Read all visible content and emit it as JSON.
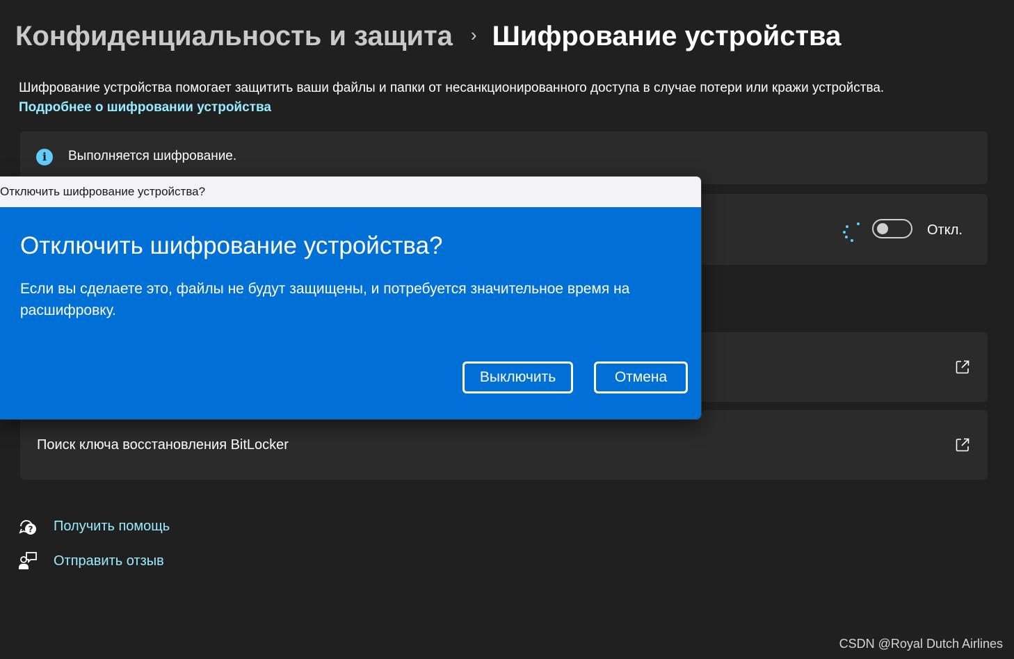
{
  "breadcrumb": {
    "parent": "Конфиденциальность и защита",
    "separator": "›",
    "current": "Шифрование устройства"
  },
  "description": "Шифрование устройства помогает защитить ваши файлы и папки от несанкционированного доступа в случае потери или кражи устройства.",
  "learn_more_link": "Подробнее о шифровании устройства",
  "status": {
    "icon": "info-icon",
    "text": "Выполняется шифрование."
  },
  "encryption_toggle": {
    "state_label": "Откл.",
    "on": false
  },
  "links": [
    {
      "label": "",
      "icon": "external-link-icon"
    },
    {
      "label": "Поиск ключа восстановления BitLocker",
      "icon": "external-link-icon"
    }
  ],
  "help": {
    "get_help": "Получить помощь",
    "send_feedback": "Отправить отзыв"
  },
  "dialog": {
    "window_title": "Отключить шифрование устройства?",
    "heading": "Отключить шифрование устройства?",
    "message": "Если вы сделаете это, файлы не будут защищены, и потребуется значительное время на расшифровку.",
    "confirm_button": "Выключить",
    "cancel_button": "Отмена"
  },
  "watermark": "CSDN @Royal Dutch Airlines",
  "colors": {
    "background": "#202020",
    "card": "#2b2b2b",
    "accent_link": "#99ebff",
    "dialog_blue": "#0070d6",
    "info_icon": "#60cdff"
  }
}
